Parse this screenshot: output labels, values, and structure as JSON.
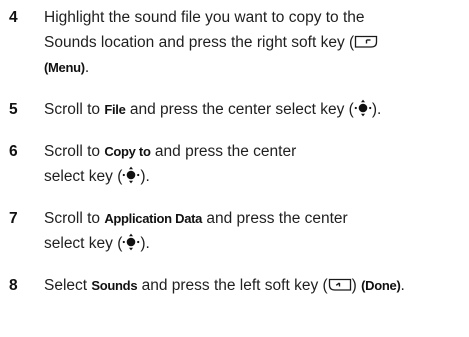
{
  "steps": [
    {
      "number": "4",
      "line1": "Highlight the sound file you want to copy to the",
      "line2_a": "Sounds location and press the right soft key (",
      "line3_kw": "(Menu)",
      "line3_end": ".",
      "icon": "right-soft-key-icon"
    },
    {
      "number": "5",
      "a": "Scroll to ",
      "kw": "File",
      "b": " and press the center select key (",
      "c": ").",
      "icon": "center-select-key-icon"
    },
    {
      "number": "6",
      "a": "Scroll to ",
      "kw": "Copy to",
      "b": " and press the center",
      "line2_a": "select key (",
      "line2_b": ").",
      "icon": "center-select-key-icon"
    },
    {
      "number": "7",
      "a": "Scroll to ",
      "kw": "Application Data",
      "b": " and press the center",
      "line2_a": "select key (",
      "line2_b": ").",
      "icon": "center-select-key-icon"
    },
    {
      "number": "8",
      "a": "Select ",
      "kw": "Sounds",
      "b": " and press the left soft key (",
      "c": ") ",
      "kw2": "(Done)",
      "d": ".",
      "icon": "left-soft-key-icon"
    }
  ]
}
